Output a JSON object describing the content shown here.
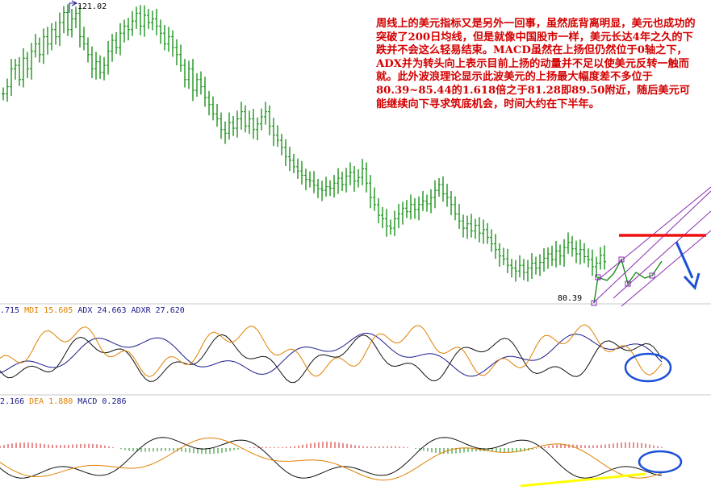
{
  "colors": {
    "candle": "#0a8a0a",
    "adx": "#1a1a8c",
    "pdi": "#111111",
    "mdi": "#e08000",
    "diff": "#111111",
    "dea": "#e08000",
    "macd_up": "#cc1f1f",
    "macd_down": "#0a8a0a",
    "annotation_red": "#ee1111",
    "annotation_blue": "#1a4fd8",
    "annotation_yellow": "#ffff00",
    "channel": "#8a2bb0",
    "note": "#d40000"
  },
  "labels": {
    "high_tag": "121.02",
    "low_tag": "80.39"
  },
  "dmi_legend": [
    {
      "text": ".715",
      "color": "#1a1a8c"
    },
    {
      "text": "MDI 15.605",
      "color": "#e08000"
    },
    {
      "text": "ADX 24.663",
      "color": "#1a1a8c"
    },
    {
      "text": "ADXR 27.620",
      "color": "#1a1a8c"
    }
  ],
  "macd_legend": [
    {
      "text": "2.166",
      "color": "#1a1a8c"
    },
    {
      "text": "DEA 1.880",
      "color": "#e08000"
    },
    {
      "text": "MACD 0.286",
      "color": "#1a1a8c"
    }
  ],
  "annotation_text": "周线上的美元指标又是另外一回事，虽然底背离明显，美元也成功的突破了200日均线，但是就像中国股市一样，美元长达4年之久的下跌并不会这么轻易结束。MACD虽然在上扬但仍然位于0轴之下，ADX并为转头向上表示目前上扬的动量并不足以使美元反转一触而就。此外波浪理论显示此波美元的上扬最大幅度差不多位于80.39~85.44的1.618倍之于81.28即89.50附近，随后美元可能继续向下寻求筑底机会，时间大约在下半年。",
  "chart_data": {
    "type": "line",
    "price": {
      "high_label": 121.02,
      "low_label": 80.39,
      "ylim": [
        80.39,
        121.02
      ],
      "series_closes": [
        109,
        110,
        112.5,
        113,
        111,
        114,
        112.5,
        115,
        116,
        114.5,
        117,
        116,
        118,
        117,
        119,
        120.4,
        118,
        119.5,
        120.3,
        117,
        116,
        114.5,
        112.5,
        113.5,
        112,
        113,
        115,
        116.5,
        115.5,
        117.5,
        118.5,
        118,
        119.2,
        120.3,
        118.5,
        120,
        119,
        119.5,
        118.5,
        117.5,
        116,
        117,
        115.5,
        114.5,
        113,
        111,
        112.5,
        109.5,
        111,
        110,
        108.5,
        107.5,
        106.2,
        105.5,
        104,
        103.5,
        105,
        104.2,
        105.5,
        106.5,
        104.5,
        105.5,
        104,
        104.8,
        105.8,
        106.5,
        104.5,
        103.2,
        102.5,
        101.5,
        100.2,
        99.7,
        98.8,
        98.2,
        97.6,
        97,
        96.8,
        96.2,
        95.7,
        95.5,
        96,
        95.8,
        96.5,
        97.2,
        96.3,
        97.5,
        98,
        96.8,
        97.3,
        98.5,
        96.5,
        94.5,
        93.5,
        92,
        91.5,
        90.5,
        90.2,
        91.5,
        92.2,
        93,
        92.5,
        93.5,
        92.8,
        93.5,
        94,
        93.6,
        94.5,
        95.5,
        96.3,
        95,
        94.5,
        93.5,
        92.2,
        91.2,
        90.2,
        90.8,
        89.8,
        90.6,
        89.5,
        90,
        88.9,
        88,
        87.2,
        86.3,
        85.9,
        85,
        84.6,
        84.2,
        85,
        84,
        84.6,
        85.3,
        84.6,
        85.4,
        86,
        86.6,
        85.8,
        87,
        86.3,
        87.5,
        88.2,
        87.3,
        86.6,
        87.2,
        86.2,
        85.8,
        84.8,
        85.3,
        86.4,
        85.5
      ]
    },
    "dmi": {
      "series": [
        {
          "name": "MDI",
          "last": 15.605
        },
        {
          "name": "ADX",
          "last": 24.663
        },
        {
          "name": "ADXR",
          "last": 27.62
        }
      ]
    },
    "macd": {
      "series": [
        {
          "name": "DEA",
          "last": 1.88
        },
        {
          "name": "MACD",
          "last": 0.286
        }
      ]
    }
  }
}
